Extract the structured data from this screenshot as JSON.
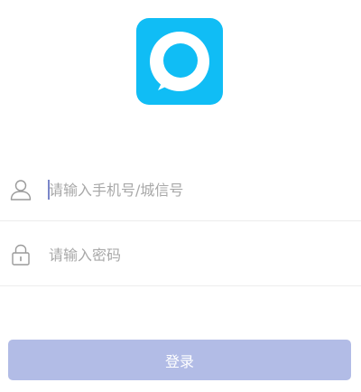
{
  "logo": {
    "icon": "chat-bubble-icon",
    "background_color": "#10bdf5"
  },
  "phone_field": {
    "icon": "user-icon",
    "placeholder": "请输入手机号/城信号",
    "value": ""
  },
  "password_field": {
    "icon": "lock-icon",
    "placeholder": "请输入密码",
    "value": ""
  },
  "login_button": {
    "label": "登录",
    "color": "#b2bce6"
  }
}
